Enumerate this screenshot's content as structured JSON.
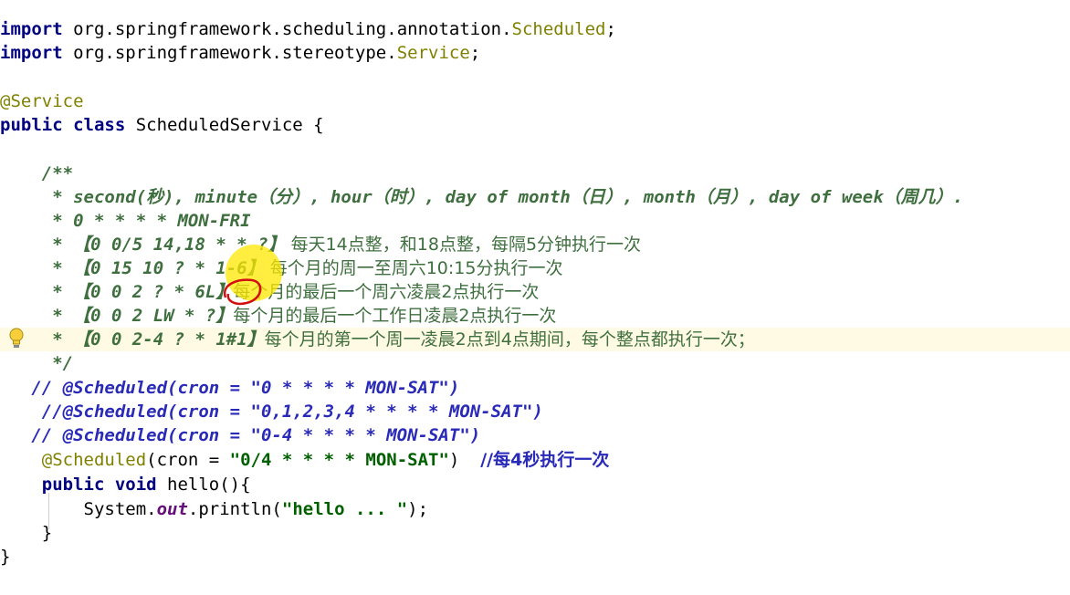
{
  "code": {
    "l1_kw": "import",
    "l1_pkg": " org.springframework.scheduling.annotation.",
    "l1_cls": "Scheduled",
    "l1_end": ";",
    "l2_kw": "import",
    "l2_pkg": " org.springframework.stereotype.",
    "l2_cls": "Service",
    "l2_end": ";",
    "l4": "@Service",
    "l5_kw": "public class",
    "l5_rest": " ScheduledService {",
    "l7": "    /**",
    "l8": "     * second(秒), minute（分）, hour（时）, day of month（日）, month（月）, day of week（周几）.",
    "l9": "     * 0 * * * * MON-FRI",
    "l10_a": "     * 【0 0/5 14,18 * * ?】",
    "l10_b": " 每天14点整，和18点整，每隔5分钟执行一次",
    "l11_a": "     * 【0 15 10 ? * 1-6】",
    "l11_b": " 每个月的周一至周六10:15分执行一次",
    "l12_a": "     * 【0 0 2 ? * 6L】",
    "l12_b": "每个月的最后一个周六凌晨2点执行一次",
    "l13_a": "     * 【0 0 2 LW * ?】",
    "l13_b": "每个月的最后一个工作日凌晨2点执行一次",
    "l14_a": "     * 【0 0 2-4 ? * 1#1】",
    "l14_b": "每个月的第一个周一凌晨2点到4点期间，每个整点都执行一次；",
    "l15": "     */",
    "l16": "   // @Scheduled(cron = \"0 * * * * MON-SAT\")",
    "l17": "    //@Scheduled(cron = \"0,1,2,3,4 * * * * MON-SAT\")",
    "l18": "   // @Scheduled(cron = \"0-4 * * * * MON-SAT\")",
    "l19_ann": "    @Scheduled",
    "l19_a": "(cron = ",
    "l19_str": "\"0/4 * * * * MON-SAT\"",
    "l19_b": ")  ",
    "l19_cmt": "//每4秒执行一次",
    "l20_kw": "    public void",
    "l20_rest": " hello(){",
    "l21_a": "        System.",
    "l21_field": "out",
    "l21_b": ".println(",
    "l21_str": "\"hello ... \"",
    "l21_c": ");",
    "l22": "    }",
    "l23": "}"
  },
  "icons": {
    "gutter": "lightbulb-icon"
  },
  "colors": {
    "keyword": "#000080",
    "annotation": "#808000",
    "doc_comment": "#3f6f3f",
    "comment": "#2a2ab8",
    "string": "#006000",
    "cursor_highlight": "#ffe800"
  }
}
